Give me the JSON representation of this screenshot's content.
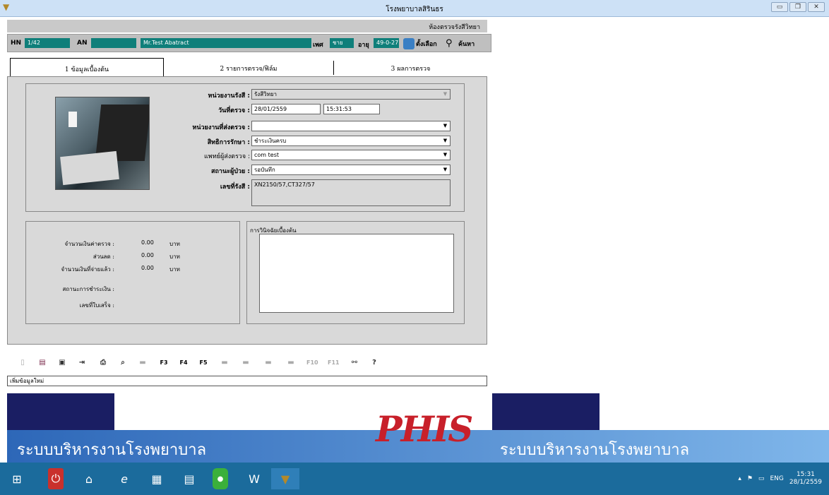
{
  "window": {
    "title": "โรงพยาบาลสิรินธร",
    "subtitle": "ห้องตรวจรังสีวิทยา"
  },
  "patient": {
    "hn_label": "HN",
    "hn": "1/42",
    "an_label": "AN",
    "an": "",
    "name": "Mr.Test Abatract",
    "sex_label": "เพศ",
    "sex": "ชาย",
    "age_label": "อายุ",
    "age": "49-0-27",
    "select_label": "ตั้งเลือก",
    "search_label": "ค้นหา"
  },
  "tabs": [
    {
      "label": "1 ข้อมูลเบื้องต้น"
    },
    {
      "label": "2 รายการตรวจ/ฟิล์ม"
    },
    {
      "label": "3 ผลการตรวจ"
    }
  ],
  "form": {
    "unit_label": "หน่วยงานรังสี :",
    "unit_value": "รังสีวิทยา",
    "date_label": "วันที่ตรวจ :",
    "date_value": "28/01/2559",
    "time_value": "15:31:53",
    "sender_label": "หน่วยงานที่ส่งตรวจ :",
    "sender_value": "",
    "rights_label": "สิทธิการรักษา :",
    "rights_value": "ชำระเงินครบ",
    "doctor_label": "แพทย์ผู้ส่งตรวจ :",
    "doctor_value": "com test",
    "status_label": "สถานะผู้ป่วย :",
    "status_value": "รอบันทึก",
    "xray_label": "เลขที่รังสี :",
    "xray_value": "XN2150/57,CT327/57"
  },
  "billing": [
    {
      "label": "จำนวนเงินค่าตรวจ :",
      "value": "0.00",
      "unit": "บาท"
    },
    {
      "label": "ส่วนลด :",
      "value": "0.00",
      "unit": "บาท"
    },
    {
      "label": "จำนวนเงินที่จ่ายแล้ว :",
      "value": "0.00",
      "unit": "บาท"
    },
    {
      "label": "สถานะการชำระเงิน :",
      "value": "",
      "unit": ""
    },
    {
      "label": "เลขที่ใบเสร็จ :",
      "value": "",
      "unit": ""
    }
  ],
  "diagnosis": {
    "label": "การวินิจฉัยเบื้องต้น",
    "value": ""
  },
  "toolbar": {
    "f3": "F3",
    "f4": "F4",
    "f5": "F5",
    "f10": "F10",
    "f11": "F11"
  },
  "status_text": "เพิ่มข้อมูลใหม่",
  "banner": {
    "left_text": "ระบบบริหารงานโรงพยาบาล",
    "right_text": "ระบบบริหารงานโรงพยาบาล",
    "logo": "PHIS"
  },
  "tray": {
    "lang": "ENG",
    "time": "15:31",
    "date": "28/1/2559"
  }
}
